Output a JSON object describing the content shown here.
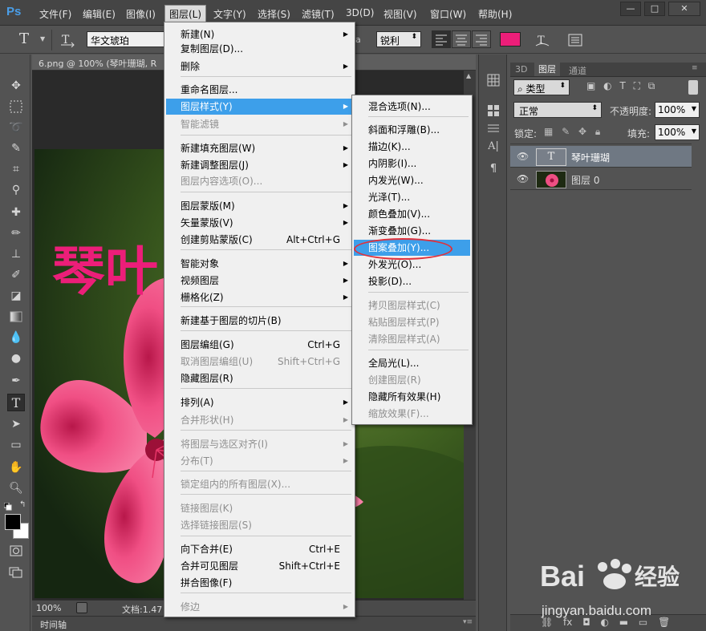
{
  "app": {
    "logo": "Ps"
  },
  "menubar": {
    "items": [
      "文件(F)",
      "编辑(E)",
      "图像(I)",
      "图层(L)",
      "文字(Y)",
      "选择(S)",
      "滤镜(T)",
      "3D(D)",
      "视图(V)",
      "窗口(W)",
      "帮助(H)"
    ],
    "window_controls": [
      "—",
      "□",
      "✕"
    ]
  },
  "options": {
    "tool_letter": "T",
    "font_family": "华文琥珀",
    "antialias": "锐利",
    "text_color": "#ec1e79"
  },
  "document": {
    "tab_title": "6.png @ 100% (琴叶珊瑚, R",
    "canvas_text": "琴叶",
    "canvas_text_color": "#ec1e79",
    "zoom": "100%",
    "doc_info": "文档:1.47",
    "timeline_label": "时间轴"
  },
  "layers_panel": {
    "tabs": [
      "3D",
      "图层",
      "通道"
    ],
    "filter_kind": "类型",
    "blend_mode": "正常",
    "opacity_label": "不透明度:",
    "opacity_value": "100%",
    "lock_label": "锁定:",
    "fill_label": "填充:",
    "fill_value": "100%",
    "layers": [
      {
        "name": "琴叶珊瑚",
        "thumb": "T",
        "selected": true
      },
      {
        "name": "图层 0",
        "selected": false
      }
    ]
  },
  "layer_menu": {
    "items": [
      {
        "label": "新建(N)",
        "submenu": true
      },
      {
        "label": "复制图层(D)..."
      },
      {
        "label": "删除",
        "submenu": true
      },
      {
        "label": "重命名图层..."
      },
      {
        "label": "图层样式(Y)",
        "submenu": true,
        "highlighted": true
      },
      {
        "label": "智能滤镜",
        "submenu": true,
        "disabled": true
      },
      {
        "label": "新建填充图层(W)",
        "submenu": true
      },
      {
        "label": "新建调整图层(J)",
        "submenu": true
      },
      {
        "label": "图层内容选项(O)...",
        "disabled": true
      },
      {
        "label": "图层蒙版(M)",
        "submenu": true
      },
      {
        "label": "矢量蒙版(V)",
        "submenu": true
      },
      {
        "label": "创建剪贴蒙版(C)",
        "shortcut": "Alt+Ctrl+G"
      },
      {
        "label": "智能对象",
        "submenu": true
      },
      {
        "label": "视频图层",
        "submenu": true
      },
      {
        "label": "栅格化(Z)",
        "submenu": true
      },
      {
        "label": "新建基于图层的切片(B)"
      },
      {
        "label": "图层编组(G)",
        "shortcut": "Ctrl+G"
      },
      {
        "label": "取消图层编组(U)",
        "shortcut": "Shift+Ctrl+G",
        "disabled": true
      },
      {
        "label": "隐藏图层(R)"
      },
      {
        "label": "排列(A)",
        "submenu": true
      },
      {
        "label": "合并形状(H)",
        "submenu": true,
        "disabled": true
      },
      {
        "label": "将图层与选区对齐(I)",
        "submenu": true,
        "disabled": true
      },
      {
        "label": "分布(T)",
        "submenu": true,
        "disabled": true
      },
      {
        "label": "锁定组内的所有图层(X)...",
        "disabled": true
      },
      {
        "label": "链接图层(K)",
        "disabled": true
      },
      {
        "label": "选择链接图层(S)",
        "disabled": true
      },
      {
        "label": "向下合并(E)",
        "shortcut": "Ctrl+E"
      },
      {
        "label": "合并可见图层",
        "shortcut": "Shift+Ctrl+E"
      },
      {
        "label": "拼合图像(F)"
      },
      {
        "label": "修边",
        "submenu": true,
        "disabled": true
      }
    ]
  },
  "style_menu": {
    "items": [
      {
        "label": "混合选项(N)..."
      },
      {
        "label": "斜面和浮雕(B)..."
      },
      {
        "label": "描边(K)..."
      },
      {
        "label": "内阴影(I)..."
      },
      {
        "label": "内发光(W)..."
      },
      {
        "label": "光泽(T)..."
      },
      {
        "label": "颜色叠加(V)..."
      },
      {
        "label": "渐变叠加(G)..."
      },
      {
        "label": "图案叠加(Y)...",
        "highlighted": true
      },
      {
        "label": "外发光(O)..."
      },
      {
        "label": "投影(D)..."
      },
      {
        "label": "拷贝图层样式(C)",
        "disabled": true
      },
      {
        "label": "粘贴图层样式(P)",
        "disabled": true
      },
      {
        "label": "清除图层样式(A)",
        "disabled": true
      },
      {
        "label": "全局光(L)..."
      },
      {
        "label": "创建图层(R)",
        "disabled": true
      },
      {
        "label": "隐藏所有效果(H)"
      },
      {
        "label": "缩放效果(F)...",
        "disabled": true
      }
    ]
  },
  "watermark": {
    "brand": "Bai",
    "brand2": "经验",
    "url": "jingyan.baidu.com"
  }
}
